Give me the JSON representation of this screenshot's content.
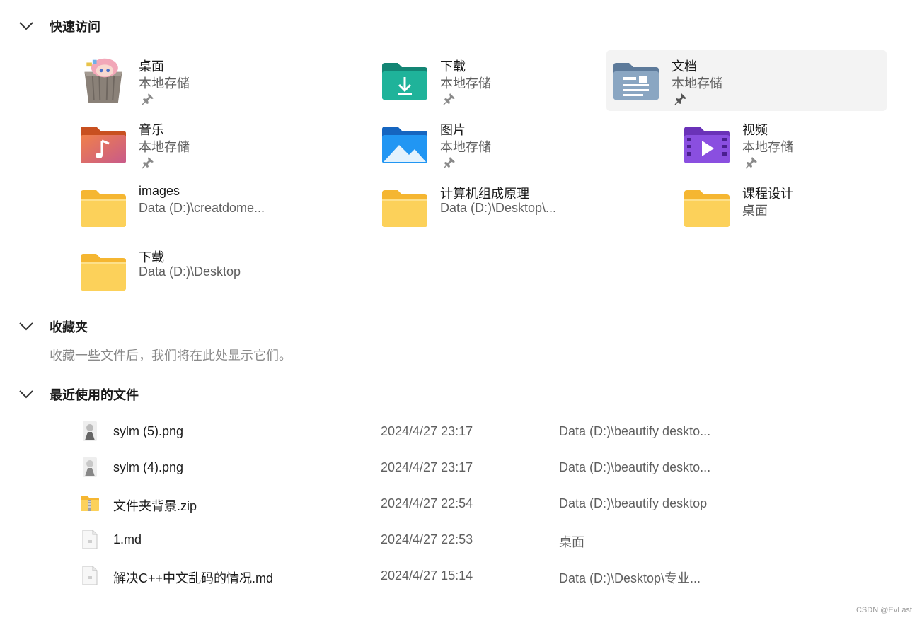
{
  "sections": {
    "quick_access": "快速访问",
    "favorites": "收藏夹",
    "recent": "最近使用的文件"
  },
  "favorites_empty": "收藏一些文件后，我们将在此处显示它们。",
  "quick_access_items": [
    {
      "name": "桌面",
      "sub": "本地存储",
      "icon": "desktop-folder-icon"
    },
    {
      "name": "下载",
      "sub": "本地存储",
      "icon": "downloads-folder-icon"
    },
    {
      "name": "文档",
      "sub": "本地存储",
      "icon": "documents-folder-icon"
    },
    {
      "name": "音乐",
      "sub": "本地存储",
      "icon": "music-folder-icon"
    },
    {
      "name": "图片",
      "sub": "本地存储",
      "icon": "pictures-folder-icon"
    },
    {
      "name": "视频",
      "sub": "本地存储",
      "icon": "videos-folder-icon"
    },
    {
      "name": "images",
      "sub": "Data (D:)\\creatdome...",
      "icon": "folder-icon"
    },
    {
      "name": "计算机组成原理",
      "sub": "Data (D:)\\Desktop\\...",
      "icon": "folder-icon"
    },
    {
      "name": "课程设计",
      "sub": "桌面",
      "icon": "folder-icon"
    },
    {
      "name": "下载",
      "sub": "Data (D:)\\Desktop",
      "icon": "folder-icon"
    }
  ],
  "recent_files": [
    {
      "name": "sylm (5).png",
      "date": "2024/4/27 23:17",
      "location": "Data (D:)\\beautify deskto...",
      "icon": "image-file-icon"
    },
    {
      "name": "sylm (4).png",
      "date": "2024/4/27 23:17",
      "location": "Data (D:)\\beautify deskto...",
      "icon": "image-file-icon"
    },
    {
      "name": "文件夹背景.zip",
      "date": "2024/4/27 22:54",
      "location": "Data (D:)\\beautify desktop",
      "icon": "zip-folder-icon"
    },
    {
      "name": "1.md",
      "date": "2024/4/27 22:53",
      "location": "桌面",
      "icon": "text-file-icon"
    },
    {
      "name": "解决C++中文乱码的情况.md",
      "date": "2024/4/27 15:14",
      "location": "Data (D:)\\Desktop\\专业...",
      "icon": "text-file-icon"
    }
  ],
  "watermark": "CSDN @EvLast",
  "colors": {
    "selected_tile": "#f3f3f3",
    "folder_yellow": "#fcd15a",
    "secondary_text": "#5f5f5f"
  }
}
